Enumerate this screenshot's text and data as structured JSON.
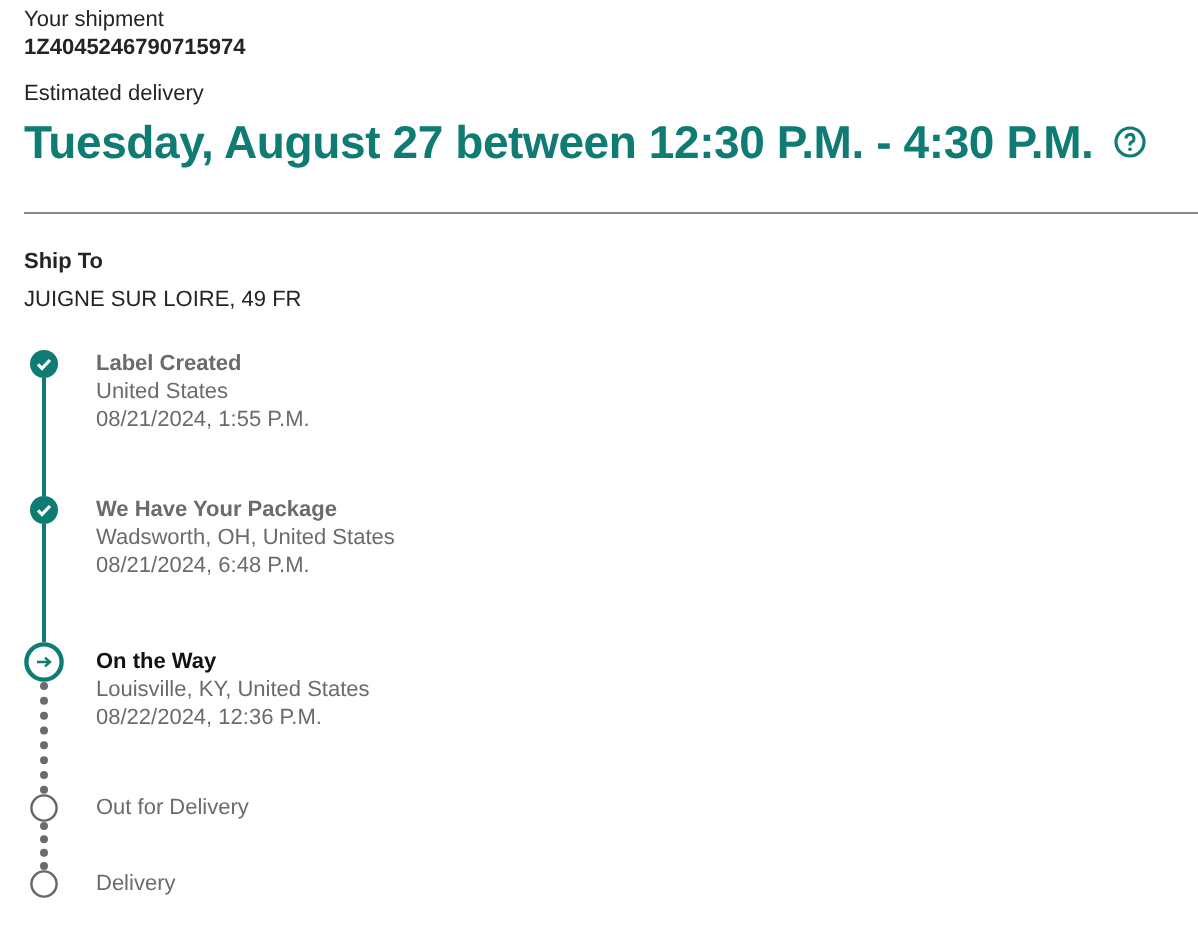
{
  "shipment": {
    "label": "Your shipment",
    "number": "1Z4045246790715974"
  },
  "delivery": {
    "label": "Estimated delivery",
    "date": "Tuesday, August 27 between 12:30 P.M. - 4:30 P.M."
  },
  "ship_to": {
    "label": "Ship To",
    "address": "JUIGNE SUR LOIRE, 49 FR"
  },
  "steps": [
    {
      "kind": "done",
      "title": "Label Created",
      "location": "United States",
      "time": "08/21/2024, 1:55 P.M."
    },
    {
      "kind": "done",
      "title": "We Have Your Package",
      "location": "Wadsworth, OH, United States",
      "time": "08/21/2024, 6:48 P.M."
    },
    {
      "kind": "current",
      "title": "On the Way",
      "location": "Louisville, KY, United States",
      "time": "08/22/2024, 12:36 P.M."
    },
    {
      "kind": "pending",
      "title": "Out for Delivery"
    },
    {
      "kind": "pending",
      "title": "Delivery"
    }
  ]
}
